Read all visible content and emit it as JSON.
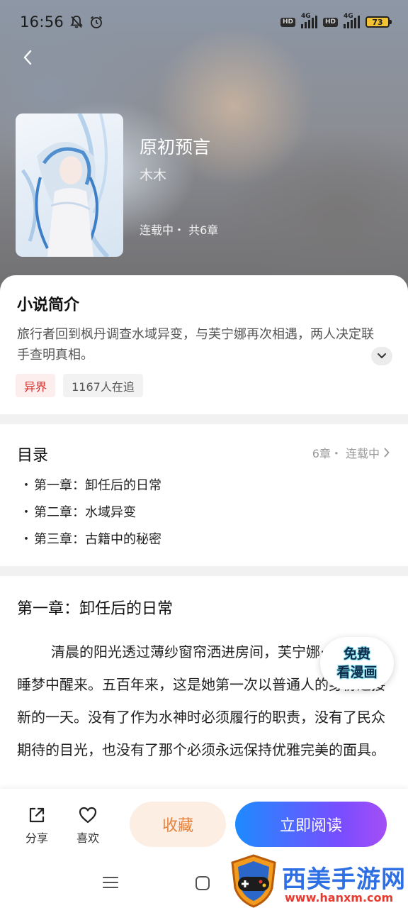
{
  "status_bar": {
    "time": "16:56",
    "network_label": "4G",
    "hd_label": "HD",
    "battery": "73"
  },
  "book": {
    "title": "原初预言",
    "author": "木木",
    "status": "连载中・ 共6章"
  },
  "intro": {
    "heading": "小说简介",
    "text": "旅行者回到枫丹调查水域异变，与芙宁娜再次相遇，两人决定联手查明真相。",
    "tags": {
      "genre": "异界",
      "followers": "1167人在追"
    }
  },
  "catalog": {
    "heading": "目录",
    "meta": "6章・ 连载中",
    "chapters": [
      {
        "bullet": "・",
        "title": "第一章：卸任后的日常"
      },
      {
        "bullet": "・",
        "title": "第二章：水域异变"
      },
      {
        "bullet": "・",
        "title": "第三章：古籍中的秘密"
      }
    ]
  },
  "reading": {
    "chapter_title": "第一章：卸任后的日常",
    "text": "清晨的阳光透过薄纱窗帘洒进房间，芙宁娜·德·枫丹从睡梦中醒来。五百年来，这是她第一次以普通人的身份迎接新的一天。没有了作为水神时必须履行的职责，没有了民众期待的目光，也没有了那个必须永远保持优雅完美的面具。"
  },
  "promo": {
    "line1": "免费",
    "line2": "看漫画"
  },
  "actions": {
    "share": "分享",
    "like": "喜欢",
    "collect": "收藏",
    "read_now": "立即阅读"
  },
  "watermark": {
    "title": "西美手游网",
    "url": "www.hanxm.com"
  },
  "colors": {
    "accent_orange": "#e8823a",
    "tag_red": "#d2302f",
    "read_gradient_start": "#1d8bff",
    "read_gradient_end": "#a44ef5"
  },
  "icons": [
    "mute-bell-icon",
    "alarm-icon",
    "back-arrow-icon",
    "chevron-down-icon",
    "chevron-right-icon",
    "share-icon",
    "heart-icon",
    "menu-icon",
    "home-icon"
  ]
}
